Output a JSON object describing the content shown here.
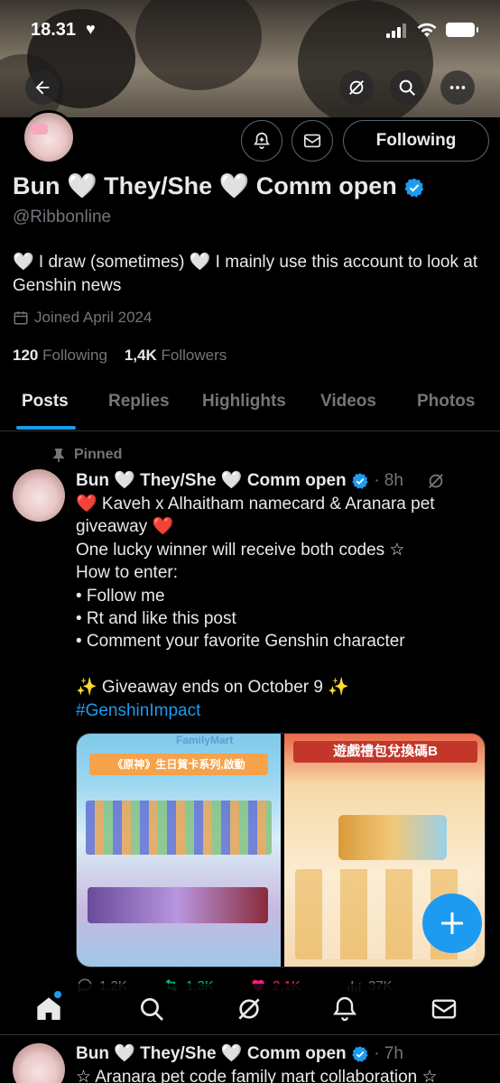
{
  "status_bar": {
    "time": "18.31",
    "heart": "♥"
  },
  "profile": {
    "name": "Bun 🤍 They/She 🤍 Comm open",
    "handle": "@Ribbonline",
    "bio": "🤍 I draw (sometimes) 🤍 I mainly use this account to look at Genshin news",
    "joined": "Joined April 2024",
    "following_count": "120",
    "following_label": "Following",
    "followers_count": "1,4K",
    "followers_label": "Followers",
    "follow_button": "Following"
  },
  "tabs": [
    "Posts",
    "Replies",
    "Highlights",
    "Videos",
    "Photos"
  ],
  "pinned_post": {
    "pinned_label": "Pinned",
    "author": "Bun 🤍 They/She 🤍 Comm open",
    "time": "· 8h",
    "lines": [
      "❤️ Kaveh x Alhaitham namecard & Aranara pet",
      "giveaway ❤️",
      "One lucky winner will receive both codes ☆",
      "How to enter:",
      "• Follow me",
      "• Rt and like this post",
      "• Comment your favorite Genshin character",
      "",
      "✨ Giveaway ends on October 9 ✨"
    ],
    "hashtag": "#GenshinImpact",
    "media_left_title": "《原神》生日賀卡系列,啟動",
    "media_left_brand": "FamilyMart",
    "media_right_title": "遊戲禮包兌換碼B",
    "replies": "1,2K",
    "reposts": "1,3K",
    "likes": "2,1K",
    "views": "37K"
  },
  "second_post": {
    "author": "Bun 🤍 They/She 🤍 Comm open",
    "time": "· 7h",
    "text": "☆ Aranara pet code family mart collaboration ☆"
  },
  "colors": {
    "accent": "#1d9bf0",
    "like": "#f91880",
    "repost": "#00ba7c",
    "muted": "#71767b"
  }
}
